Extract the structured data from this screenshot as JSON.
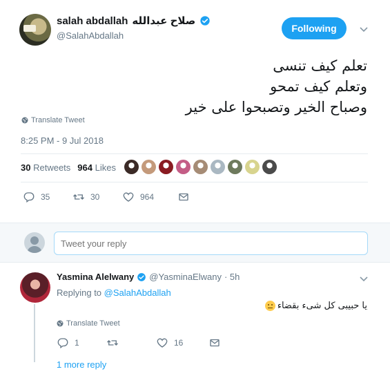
{
  "tweet": {
    "author": {
      "name": "salah abdallah",
      "name_ar": "صلاح عبدالله",
      "handle": "@SalahAbdallah"
    },
    "follow_label": "Following",
    "text_lines": [
      "تعلم كيف تنسى",
      "وتعلم كيف تمحو",
      "وصباح الخير وتصبحوا على خير"
    ],
    "translate_label": "Translate Tweet",
    "timestamp": "8:25 PM - 9 Jul 2018",
    "stats": {
      "retweets_count": "30",
      "retweets_label": "Retweets",
      "likes_count": "964",
      "likes_label": "Likes"
    },
    "liker_colors": [
      "#3b2a26",
      "#c49a7b",
      "#8a1c22",
      "#c45d86",
      "#a68c76",
      "#aab8c2",
      "#6e7a5d",
      "#d8d48e",
      "#4b4b4b"
    ],
    "actions": {
      "replies": "35",
      "retweets": "30",
      "likes": "964"
    }
  },
  "reply_box": {
    "placeholder": "Tweet your reply"
  },
  "reply": {
    "name": "Yasmina Alelwany",
    "handle": "@YasminaElwany",
    "time": "· 5h",
    "replying_prefix": "Replying to",
    "replying_to": "@SalahAbdallah",
    "text": "يا حبيبى كل شىء بقضاء",
    "translate_label": "Translate Tweet",
    "actions": {
      "replies": "1",
      "retweets": "",
      "likes": "16"
    },
    "more_replies": "1 more reply"
  },
  "colors": {
    "accent": "#1da1f2",
    "muted": "#657786",
    "divider": "#e6ecf0"
  }
}
